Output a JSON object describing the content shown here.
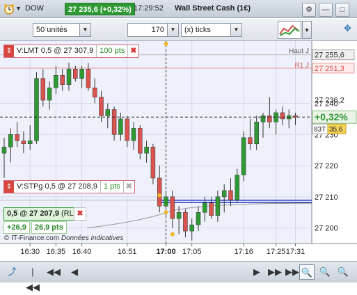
{
  "topbar": {
    "symbol": "DOW",
    "price": "27 235,6 (+0,32%)",
    "time": "17:29:52",
    "instrument": "Wall Street Cash (1€)"
  },
  "toolbar": {
    "units_value": "50 unités",
    "ticks_value": "170",
    "ticks_unit": "(x) ticks"
  },
  "axis": {
    "price_labels": [
      "27 240",
      "27 230",
      "27 220",
      "27 210",
      "27 200"
    ],
    "time_labels": [
      "16:30",
      "16:35",
      "16:40",
      "16:51",
      "17:00",
      "17:05",
      "17:16",
      "17:25",
      "17:31"
    ],
    "haut_label": "Haut J",
    "haut_value": "27 255,6",
    "r1_label": "R1 J",
    "r1_value": "27 251,3",
    "tag_27236": "27 236,2",
    "change": "+0,32%",
    "ticks_count": "83T",
    "ticks_value": "35,6"
  },
  "orders": {
    "limit_label": "V:LMT  0,5 @ 27 307,9",
    "limit_pts": "100 pts",
    "stop_label": "V:STPg  0,5 @ 27 208,9",
    "stop_pts": "1 pts"
  },
  "position": {
    "label": "0,5 @ 27 207,9",
    "suffix": "(RL)",
    "pnl_points": "+26,9",
    "pnl_value": "26,9 pts"
  },
  "footer": {
    "copyright": "© IT-Finance.com",
    "disclaimer": "Données indicatives"
  },
  "colors": {
    "bull": "#2f9a34",
    "bear": "#d9534f",
    "stop_line": "#1a2fc0",
    "resistance": "#d9534f"
  },
  "chart_data": {
    "type": "candlestick",
    "x_labels": [
      "16:30",
      "16:35",
      "16:40",
      "16:51",
      "17:00",
      "17:05",
      "17:16",
      "17:25",
      "17:31"
    ],
    "y_range": [
      27195,
      27260
    ],
    "candles": [
      {
        "o": 27224,
        "h": 27229,
        "l": 27216,
        "c": 27226
      },
      {
        "o": 27226,
        "h": 27232,
        "l": 27221,
        "c": 27230
      },
      {
        "o": 27230,
        "h": 27234,
        "l": 27226,
        "c": 27228
      },
      {
        "o": 27228,
        "h": 27231,
        "l": 27224,
        "c": 27227
      },
      {
        "o": 27227,
        "h": 27233,
        "l": 27225,
        "c": 27228
      },
      {
        "o": 27228,
        "h": 27250,
        "l": 27227,
        "c": 27248
      },
      {
        "o": 27248,
        "h": 27251,
        "l": 27239,
        "c": 27241
      },
      {
        "o": 27241,
        "h": 27247,
        "l": 27238,
        "c": 27245
      },
      {
        "o": 27245,
        "h": 27252,
        "l": 27243,
        "c": 27249
      },
      {
        "o": 27249,
        "h": 27251,
        "l": 27244,
        "c": 27246
      },
      {
        "o": 27246,
        "h": 27253,
        "l": 27244,
        "c": 27251
      },
      {
        "o": 27251,
        "h": 27252,
        "l": 27247,
        "c": 27248
      },
      {
        "o": 27248,
        "h": 27252,
        "l": 27245,
        "c": 27251
      },
      {
        "o": 27251,
        "h": 27253,
        "l": 27244,
        "c": 27245
      },
      {
        "o": 27245,
        "h": 27248,
        "l": 27240,
        "c": 27242
      },
      {
        "o": 27242,
        "h": 27244,
        "l": 27234,
        "c": 27236
      },
      {
        "o": 27236,
        "h": 27240,
        "l": 27232,
        "c": 27238
      },
      {
        "o": 27238,
        "h": 27239,
        "l": 27228,
        "c": 27230
      },
      {
        "o": 27230,
        "h": 27237,
        "l": 27228,
        "c": 27235
      },
      {
        "o": 27235,
        "h": 27236,
        "l": 27226,
        "c": 27228
      },
      {
        "o": 27228,
        "h": 27234,
        "l": 27225,
        "c": 27232
      },
      {
        "o": 27232,
        "h": 27233,
        "l": 27222,
        "c": 27224
      },
      {
        "o": 27224,
        "h": 27228,
        "l": 27221,
        "c": 27226
      },
      {
        "o": 27226,
        "h": 27227,
        "l": 27214,
        "c": 27216
      },
      {
        "o": 27216,
        "h": 27220,
        "l": 27205,
        "c": 27207
      },
      {
        "o": 27207,
        "h": 27212,
        "l": 27203,
        "c": 27210
      },
      {
        "o": 27210,
        "h": 27212,
        "l": 27200,
        "c": 27203
      },
      {
        "o": 27203,
        "h": 27207,
        "l": 27198,
        "c": 27205
      },
      {
        "o": 27205,
        "h": 27206,
        "l": 27197,
        "c": 27199
      },
      {
        "o": 27199,
        "h": 27203,
        "l": 27196,
        "c": 27201
      },
      {
        "o": 27201,
        "h": 27207,
        "l": 27199,
        "c": 27205
      },
      {
        "o": 27205,
        "h": 27210,
        "l": 27202,
        "c": 27208
      },
      {
        "o": 27208,
        "h": 27210,
        "l": 27203,
        "c": 27204
      },
      {
        "o": 27204,
        "h": 27212,
        "l": 27202,
        "c": 27210
      },
      {
        "o": 27210,
        "h": 27214,
        "l": 27205,
        "c": 27212
      },
      {
        "o": 27212,
        "h": 27216,
        "l": 27207,
        "c": 27209
      },
      {
        "o": 27209,
        "h": 27219,
        "l": 27208,
        "c": 27217
      },
      {
        "o": 27217,
        "h": 27231,
        "l": 27215,
        "c": 27229
      },
      {
        "o": 27229,
        "h": 27235,
        "l": 27225,
        "c": 27227
      },
      {
        "o": 27227,
        "h": 27236,
        "l": 27225,
        "c": 27234
      },
      {
        "o": 27234,
        "h": 27237,
        "l": 27229,
        "c": 27236
      },
      {
        "o": 27236,
        "h": 27242,
        "l": 27232,
        "c": 27234
      },
      {
        "o": 27234,
        "h": 27238,
        "l": 27230,
        "c": 27237
      },
      {
        "o": 27237,
        "h": 27239,
        "l": 27233,
        "c": 27235
      },
      {
        "o": 27235,
        "h": 27238,
        "l": 27232,
        "c": 27236
      },
      {
        "o": 27236,
        "h": 27237,
        "l": 27233,
        "c": 27235.6
      }
    ],
    "levels": {
      "haut": 27255.6,
      "r1": 27251.3,
      "last": 27235.6,
      "stop": 27208.9,
      "entry": 27207.9
    }
  }
}
